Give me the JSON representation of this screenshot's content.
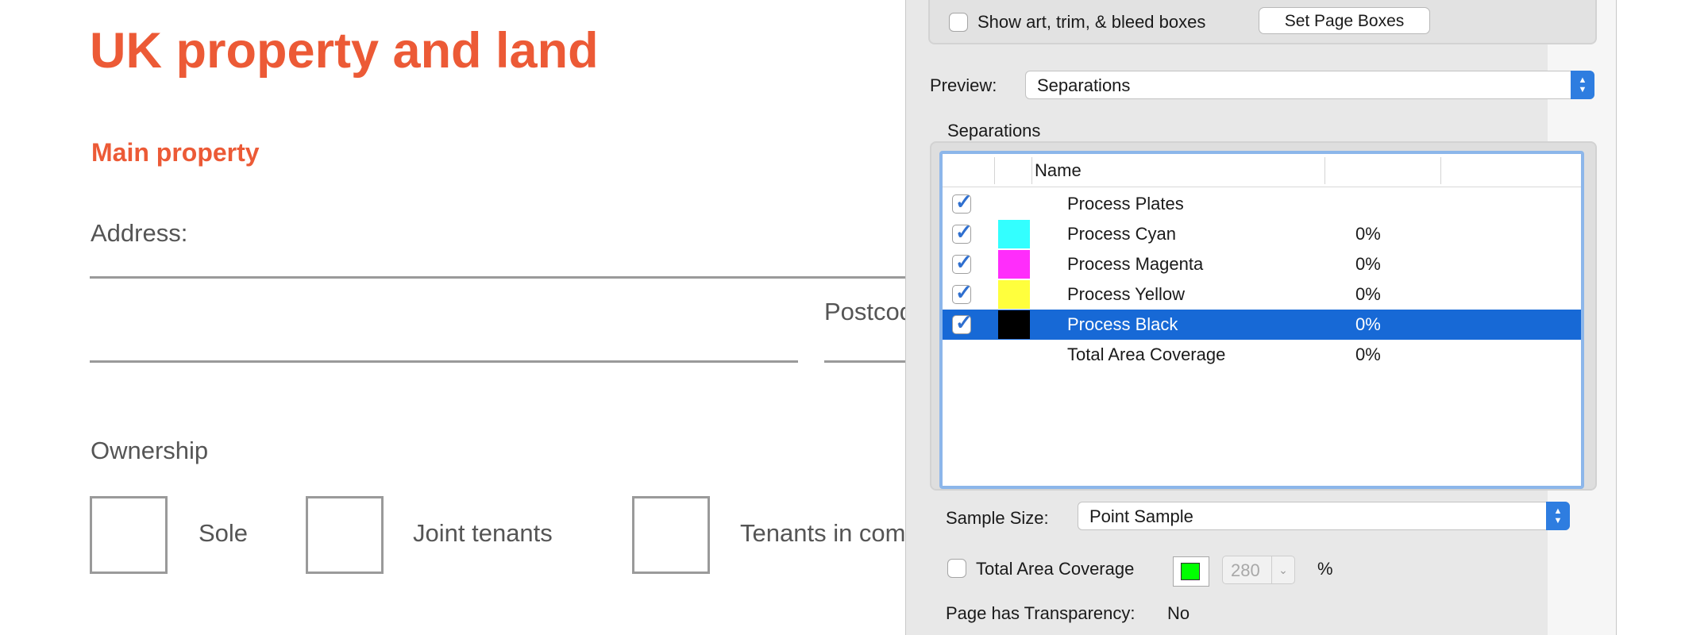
{
  "document": {
    "title": "UK property and land",
    "subtitle": "Main property",
    "address_label": "Address:",
    "postcode_label": "Postcod",
    "ownership_label": "Ownership",
    "options": [
      "Sole",
      "Joint tenants",
      "Tenants in com"
    ]
  },
  "panel": {
    "show_boxes_label": "Show art, trim, & bleed boxes",
    "set_page_boxes_label": "Set Page Boxes",
    "preview_label": "Preview:",
    "preview_value": "Separations",
    "separations_group_label": "Separations",
    "table": {
      "name_header": "Name",
      "rows": [
        {
          "name": "Process Plates",
          "checked": true,
          "swatch": "",
          "percent": ""
        },
        {
          "name": "Process Cyan",
          "checked": true,
          "swatch": "#33ffff",
          "percent": "0%"
        },
        {
          "name": "Process Magenta",
          "checked": true,
          "swatch": "#ff2dfb",
          "percent": "0%"
        },
        {
          "name": "Process Yellow",
          "checked": true,
          "swatch": "#ffff3d",
          "percent": "0%"
        },
        {
          "name": "Process Black",
          "checked": true,
          "swatch": "#000000",
          "percent": "0%",
          "selected": true
        },
        {
          "name": "Total Area Coverage",
          "checked": false,
          "swatch": "",
          "percent": "0%"
        }
      ]
    },
    "sample_size_label": "Sample Size:",
    "sample_size_value": "Point Sample",
    "tac_label": "Total Area Coverage",
    "tac_color": "#00ff00",
    "tac_value": "280",
    "tac_unit": "%",
    "transparency_label": "Page has Transparency:",
    "transparency_value": "No"
  },
  "colors": {
    "accent": "#ec5a36",
    "selection": "#1769d6",
    "focus_ring": "#8cb6ea"
  }
}
